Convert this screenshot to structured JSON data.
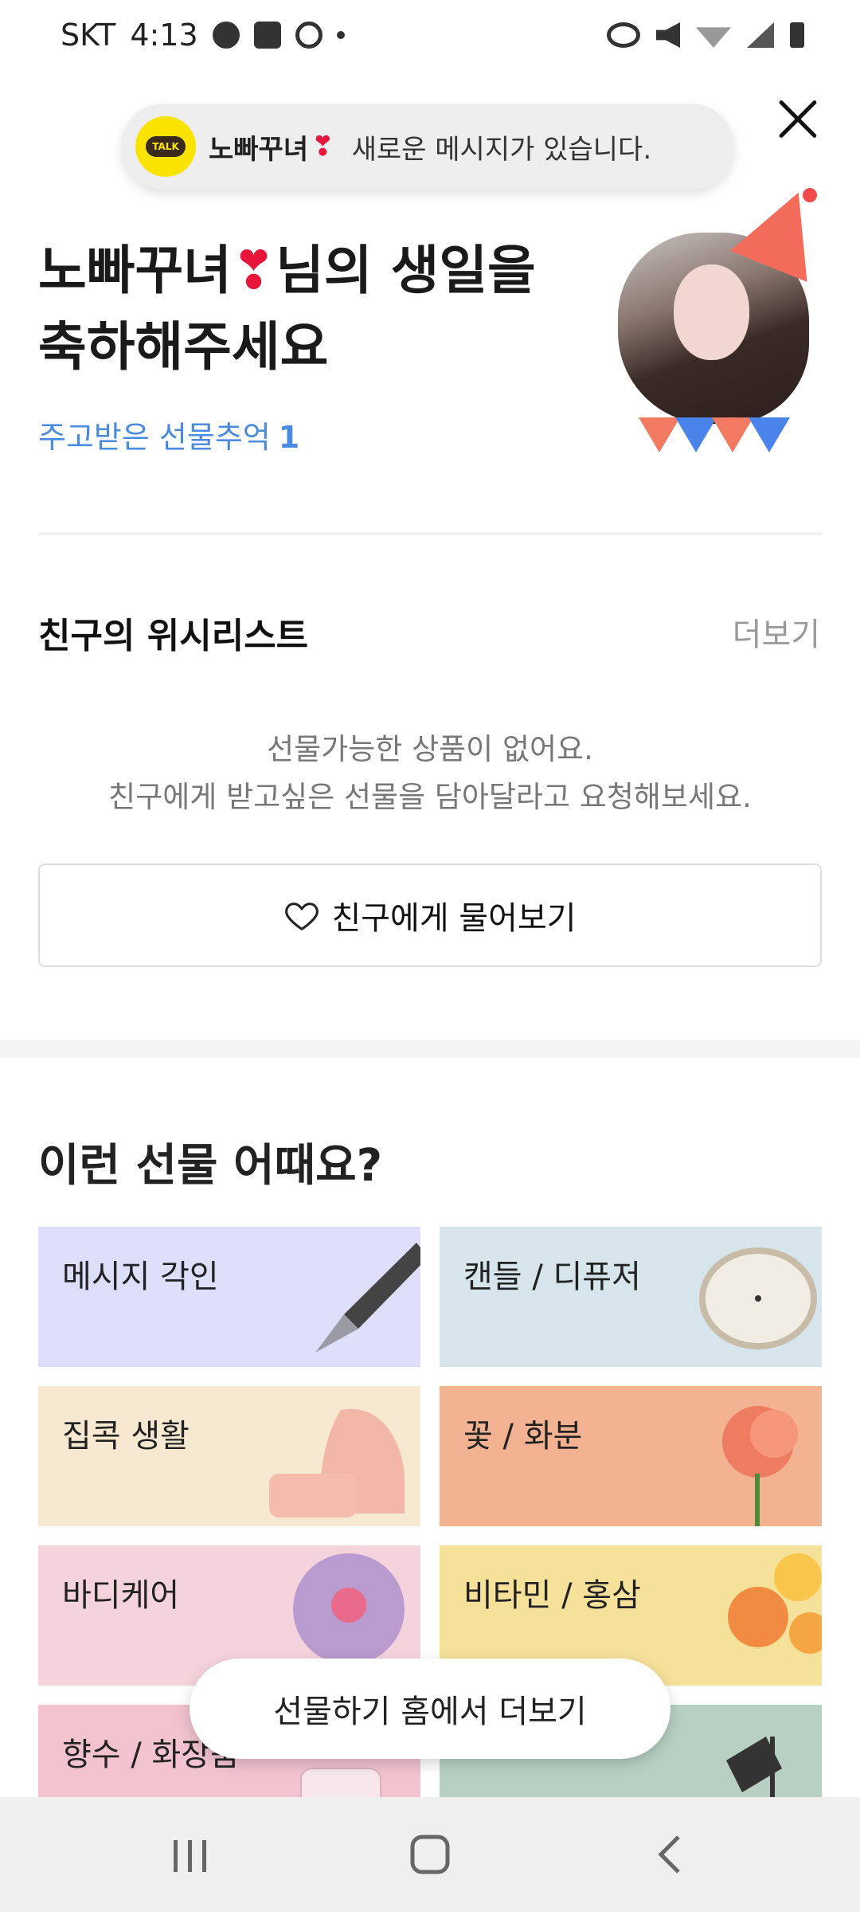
{
  "status_bar": {
    "carrier": "SKT",
    "time": "4:13"
  },
  "toast": {
    "icon_text": "TALK",
    "sender": "노빠꾸녀",
    "heart": "❣",
    "message": "새로운 메시지가 있습니다."
  },
  "birthday": {
    "name": "노빠꾸녀",
    "heart": "❣",
    "title_suffix": "님의 생일을",
    "title_line2": "축하해주세요",
    "gift_memory_label": "주고받은 선물추억",
    "gift_memory_count": "1"
  },
  "wishlist": {
    "title": "친구의 위시리스트",
    "more": "더보기",
    "empty_line1": "선물가능한 상품이 없어요.",
    "empty_line2": "친구에게 받고싶은 선물을 담아달라고 요청해보세요.",
    "ask_button": "친구에게 물어보기"
  },
  "recommend": {
    "title": "이런 선물 어때요?",
    "tiles": [
      {
        "label": "메시지 각인",
        "bg": "#dcdefa"
      },
      {
        "label": "캔들 / 디퓨저",
        "bg": "#d6e4ec"
      },
      {
        "label": "집콕 생활",
        "bg": "#f7e8d2"
      },
      {
        "label": "꽃 / 화분",
        "bg": "#f3b291"
      },
      {
        "label": "바디케어",
        "bg": "#f5d3dc"
      },
      {
        "label": "비타민 / 홍삼",
        "bg": "#f5e19a"
      },
      {
        "label": "향수 / 화장품",
        "bg": "#f2c2cf"
      },
      {
        "label": "",
        "bg": "#b8d0c4"
      }
    ]
  },
  "floating_button": "선물하기 홈에서 더보기",
  "colors": {
    "accent_blue": "#4a8be0",
    "kakao_yellow": "#fbe300",
    "heart_red": "#e8153a"
  }
}
